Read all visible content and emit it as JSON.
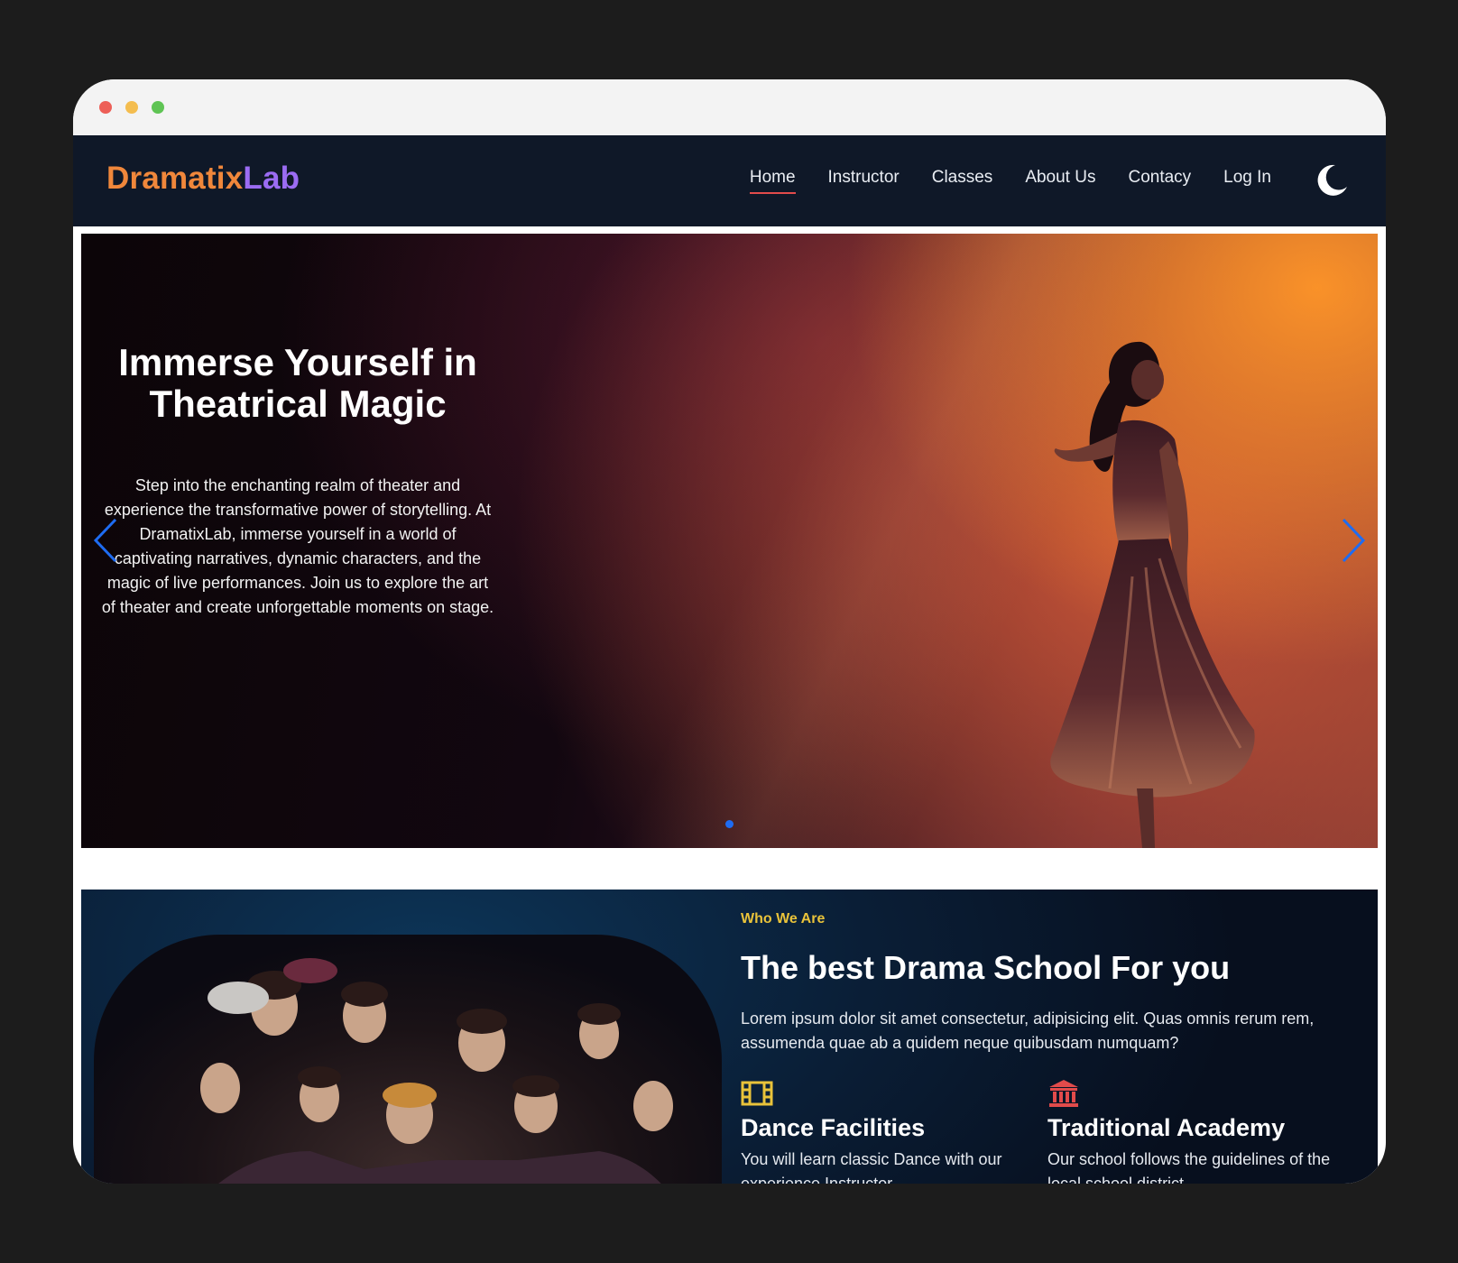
{
  "brand": {
    "part1": "Dramatix",
    "part2": "Lab"
  },
  "nav": {
    "items": [
      {
        "label": "Home"
      },
      {
        "label": "Instructor"
      },
      {
        "label": "Classes"
      },
      {
        "label": "About Us"
      },
      {
        "label": "Contacy"
      },
      {
        "label": "Log In"
      }
    ],
    "active": "Home",
    "theme_toggle_icon": "moon-icon"
  },
  "hero": {
    "title": "Immerse Yourself in Theatrical Magic",
    "description": "Step into the enchanting realm of theater and experience the transformative power of storytelling. At DramatixLab, immerse yourself in a world of captivating narratives, dynamic characters, and the magic of live performances. Join us to explore the art of theater and create unforgettable moments on stage.",
    "prev_icon": "chevron-left-icon",
    "next_icon": "chevron-right-icon",
    "slide_count": 1,
    "active_slide": 1
  },
  "about": {
    "eyebrow": "Who We Are",
    "title": "The best Drama School For you",
    "description": "Lorem ipsum dolor sit amet consectetur, adipisicing elit. Quas omnis rerum rem, assumenda quae ab a quidem neque quibusdam numquam?",
    "features": [
      {
        "icon": "film-icon",
        "title": "Dance Facilities",
        "description": "You will learn classic Dance with our experience Instructor"
      },
      {
        "icon": "institution-icon",
        "title": "Traditional Academy",
        "description": "Our school follows the guidelines of the local school district"
      }
    ]
  },
  "colors": {
    "logo_primary": "#f0873b",
    "logo_secondary": "#9b6cf3",
    "navbar_bg": "#0f1828",
    "active_underline": "#e24b4b",
    "eyebrow": "#e9c33a",
    "arrow": "#1e6cf2"
  }
}
